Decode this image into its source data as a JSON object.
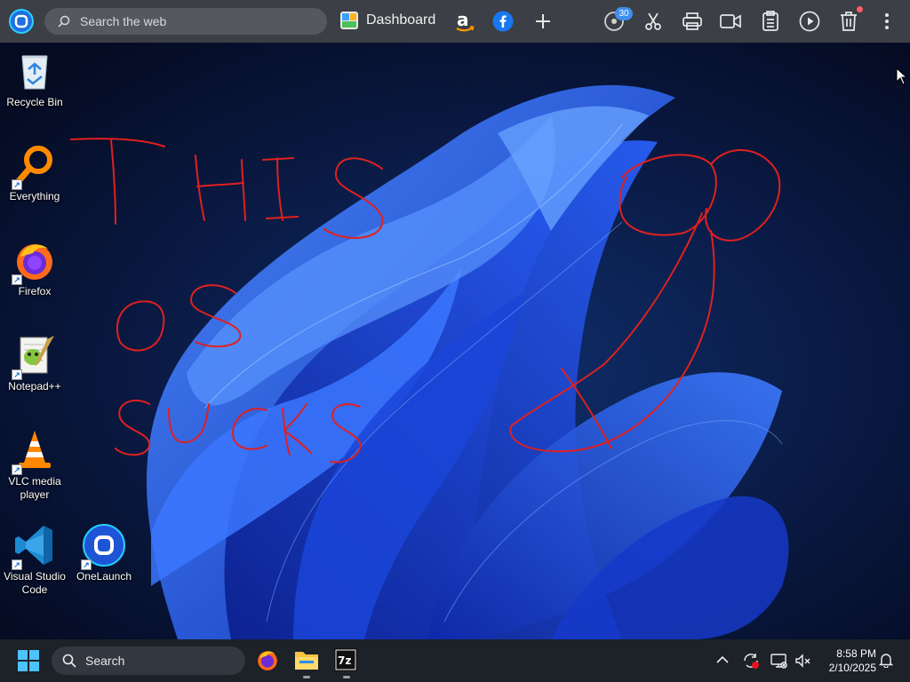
{
  "launcher": {
    "search_placeholder": "Search the web",
    "dashboard_label": "Dashboard",
    "badge_count": "30",
    "icons": [
      "onelaunch-logo-icon",
      "search-icon",
      "dashboard-icon",
      "amazon-icon",
      "facebook-icon",
      "plus-icon",
      "badge-icon",
      "scissors-icon",
      "printer-icon",
      "video-icon",
      "clipboard-icon",
      "play-icon",
      "trash-icon",
      "more-icon"
    ]
  },
  "desktop": {
    "icons": [
      {
        "label": "Recycle Bin"
      },
      {
        "label": "Everything"
      },
      {
        "label": "Firefox"
      },
      {
        "label": "Notepad++"
      },
      {
        "label": "VLC media player"
      },
      {
        "label": "Visual Studio Code"
      },
      {
        "label": "OneLaunch"
      }
    ],
    "scribble": "THIS OS SUCKS"
  },
  "taskbar": {
    "search_placeholder": "Search",
    "time": "8:58 PM",
    "date": "2/10/2025",
    "pinned": [
      "firefox-icon",
      "file-explorer-icon",
      "7zip-icon"
    ]
  }
}
